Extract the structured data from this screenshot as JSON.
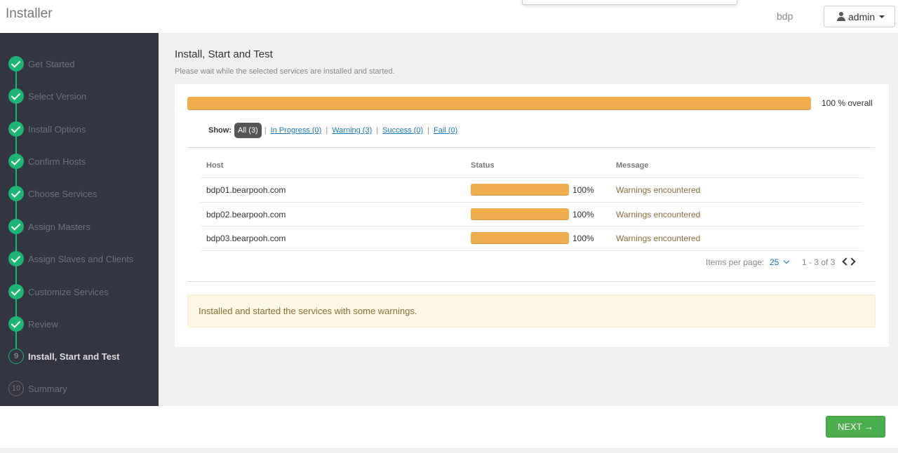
{
  "header": {
    "app_title": "Installer",
    "cluster_name": "bdp",
    "user_label": "admin"
  },
  "sidebar": {
    "steps": [
      {
        "label": "Get Started",
        "state": "done"
      },
      {
        "label": "Select Version",
        "state": "done"
      },
      {
        "label": "Install Options",
        "state": "done"
      },
      {
        "label": "Confirm Hosts",
        "state": "done"
      },
      {
        "label": "Choose Services",
        "state": "done"
      },
      {
        "label": "Assign Masters",
        "state": "done"
      },
      {
        "label": "Assign Slaves and Clients",
        "state": "done"
      },
      {
        "label": "Customize Services",
        "state": "done"
      },
      {
        "label": "Review",
        "state": "done"
      },
      {
        "label": "Install, Start and Test",
        "state": "current",
        "number": "9"
      },
      {
        "label": "Summary",
        "state": "pending",
        "number": "10"
      }
    ]
  },
  "main": {
    "title": "Install, Start and Test",
    "subtitle": "Please wait while the selected services are installed and started.",
    "overall_progress": 100,
    "overall_label": "100 % overall",
    "filters": {
      "show_label": "Show:",
      "all": "All (3)",
      "in_progress": "In Progress (0)",
      "warning": "Warning (3)",
      "success": "Success (0)",
      "fail": "Fail (0)",
      "separator": "|"
    },
    "table": {
      "headers": {
        "host": "Host",
        "status": "Status",
        "message": "Message"
      },
      "rows": [
        {
          "host": "bdp01.bearpooh.com",
          "progress": 100,
          "percent": "100%",
          "message": "Warnings encountered"
        },
        {
          "host": "bdp02.bearpooh.com",
          "progress": 100,
          "percent": "100%",
          "message": "Warnings encountered"
        },
        {
          "host": "bdp03.bearpooh.com",
          "progress": 100,
          "percent": "100%",
          "message": "Warnings encountered"
        }
      ]
    },
    "pagination": {
      "items_per_page_label": "Items per page:",
      "items_per_page": "25",
      "range": "1 - 3 of 3"
    },
    "alert": "Installed and started the services with some warnings."
  },
  "footer": {
    "next_label": "NEXT →"
  },
  "colors": {
    "sidebar_bg": "#333642",
    "step_done": "#1eb475",
    "progress": "#f0ad4e",
    "next_button": "#4cae4c",
    "alert_bg": "#fcf8e3"
  }
}
